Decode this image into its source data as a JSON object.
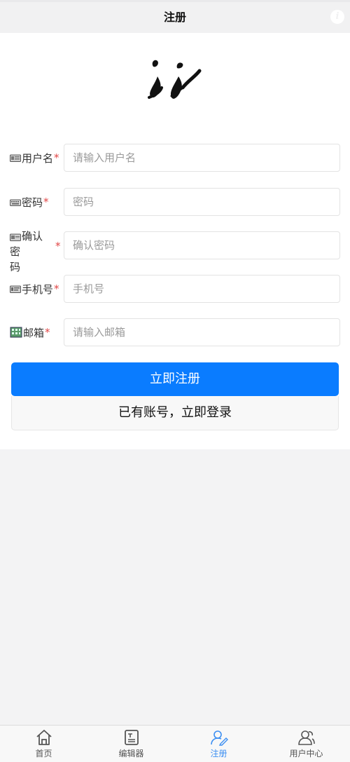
{
  "header": {
    "title": "注册",
    "info_icon": "info-icon"
  },
  "form": {
    "fields": [
      {
        "label": "用户名",
        "required": "*",
        "placeholder": "请输入用户名",
        "icon": "user-card-icon"
      },
      {
        "label": "密码",
        "required": "*",
        "placeholder": "密码",
        "icon": "keyboard-icon"
      },
      {
        "label": "确认密码",
        "label_line1": "确认密",
        "label_line2": "码",
        "required": "*",
        "placeholder": "确认密码",
        "icon": "confirm-card-icon"
      },
      {
        "label": "手机号",
        "required": "*",
        "placeholder": "手机号",
        "icon": "phone-card-icon"
      },
      {
        "label": "邮箱",
        "required": "*",
        "placeholder": "请输入邮箱",
        "icon": "building-icon"
      }
    ],
    "submit_label": "立即注册",
    "login_label": "已有账号，立即登录"
  },
  "tabbar": {
    "items": [
      {
        "label": "首页",
        "icon": "home-icon",
        "active": false
      },
      {
        "label": "编辑器",
        "icon": "editor-icon",
        "active": false
      },
      {
        "label": "注册",
        "icon": "register-icon",
        "active": true
      },
      {
        "label": "用户中心",
        "icon": "users-icon",
        "active": false
      }
    ]
  },
  "colors": {
    "primary": "#0a7cff",
    "active_tab": "#3d8ff2",
    "required": "#e14646"
  }
}
